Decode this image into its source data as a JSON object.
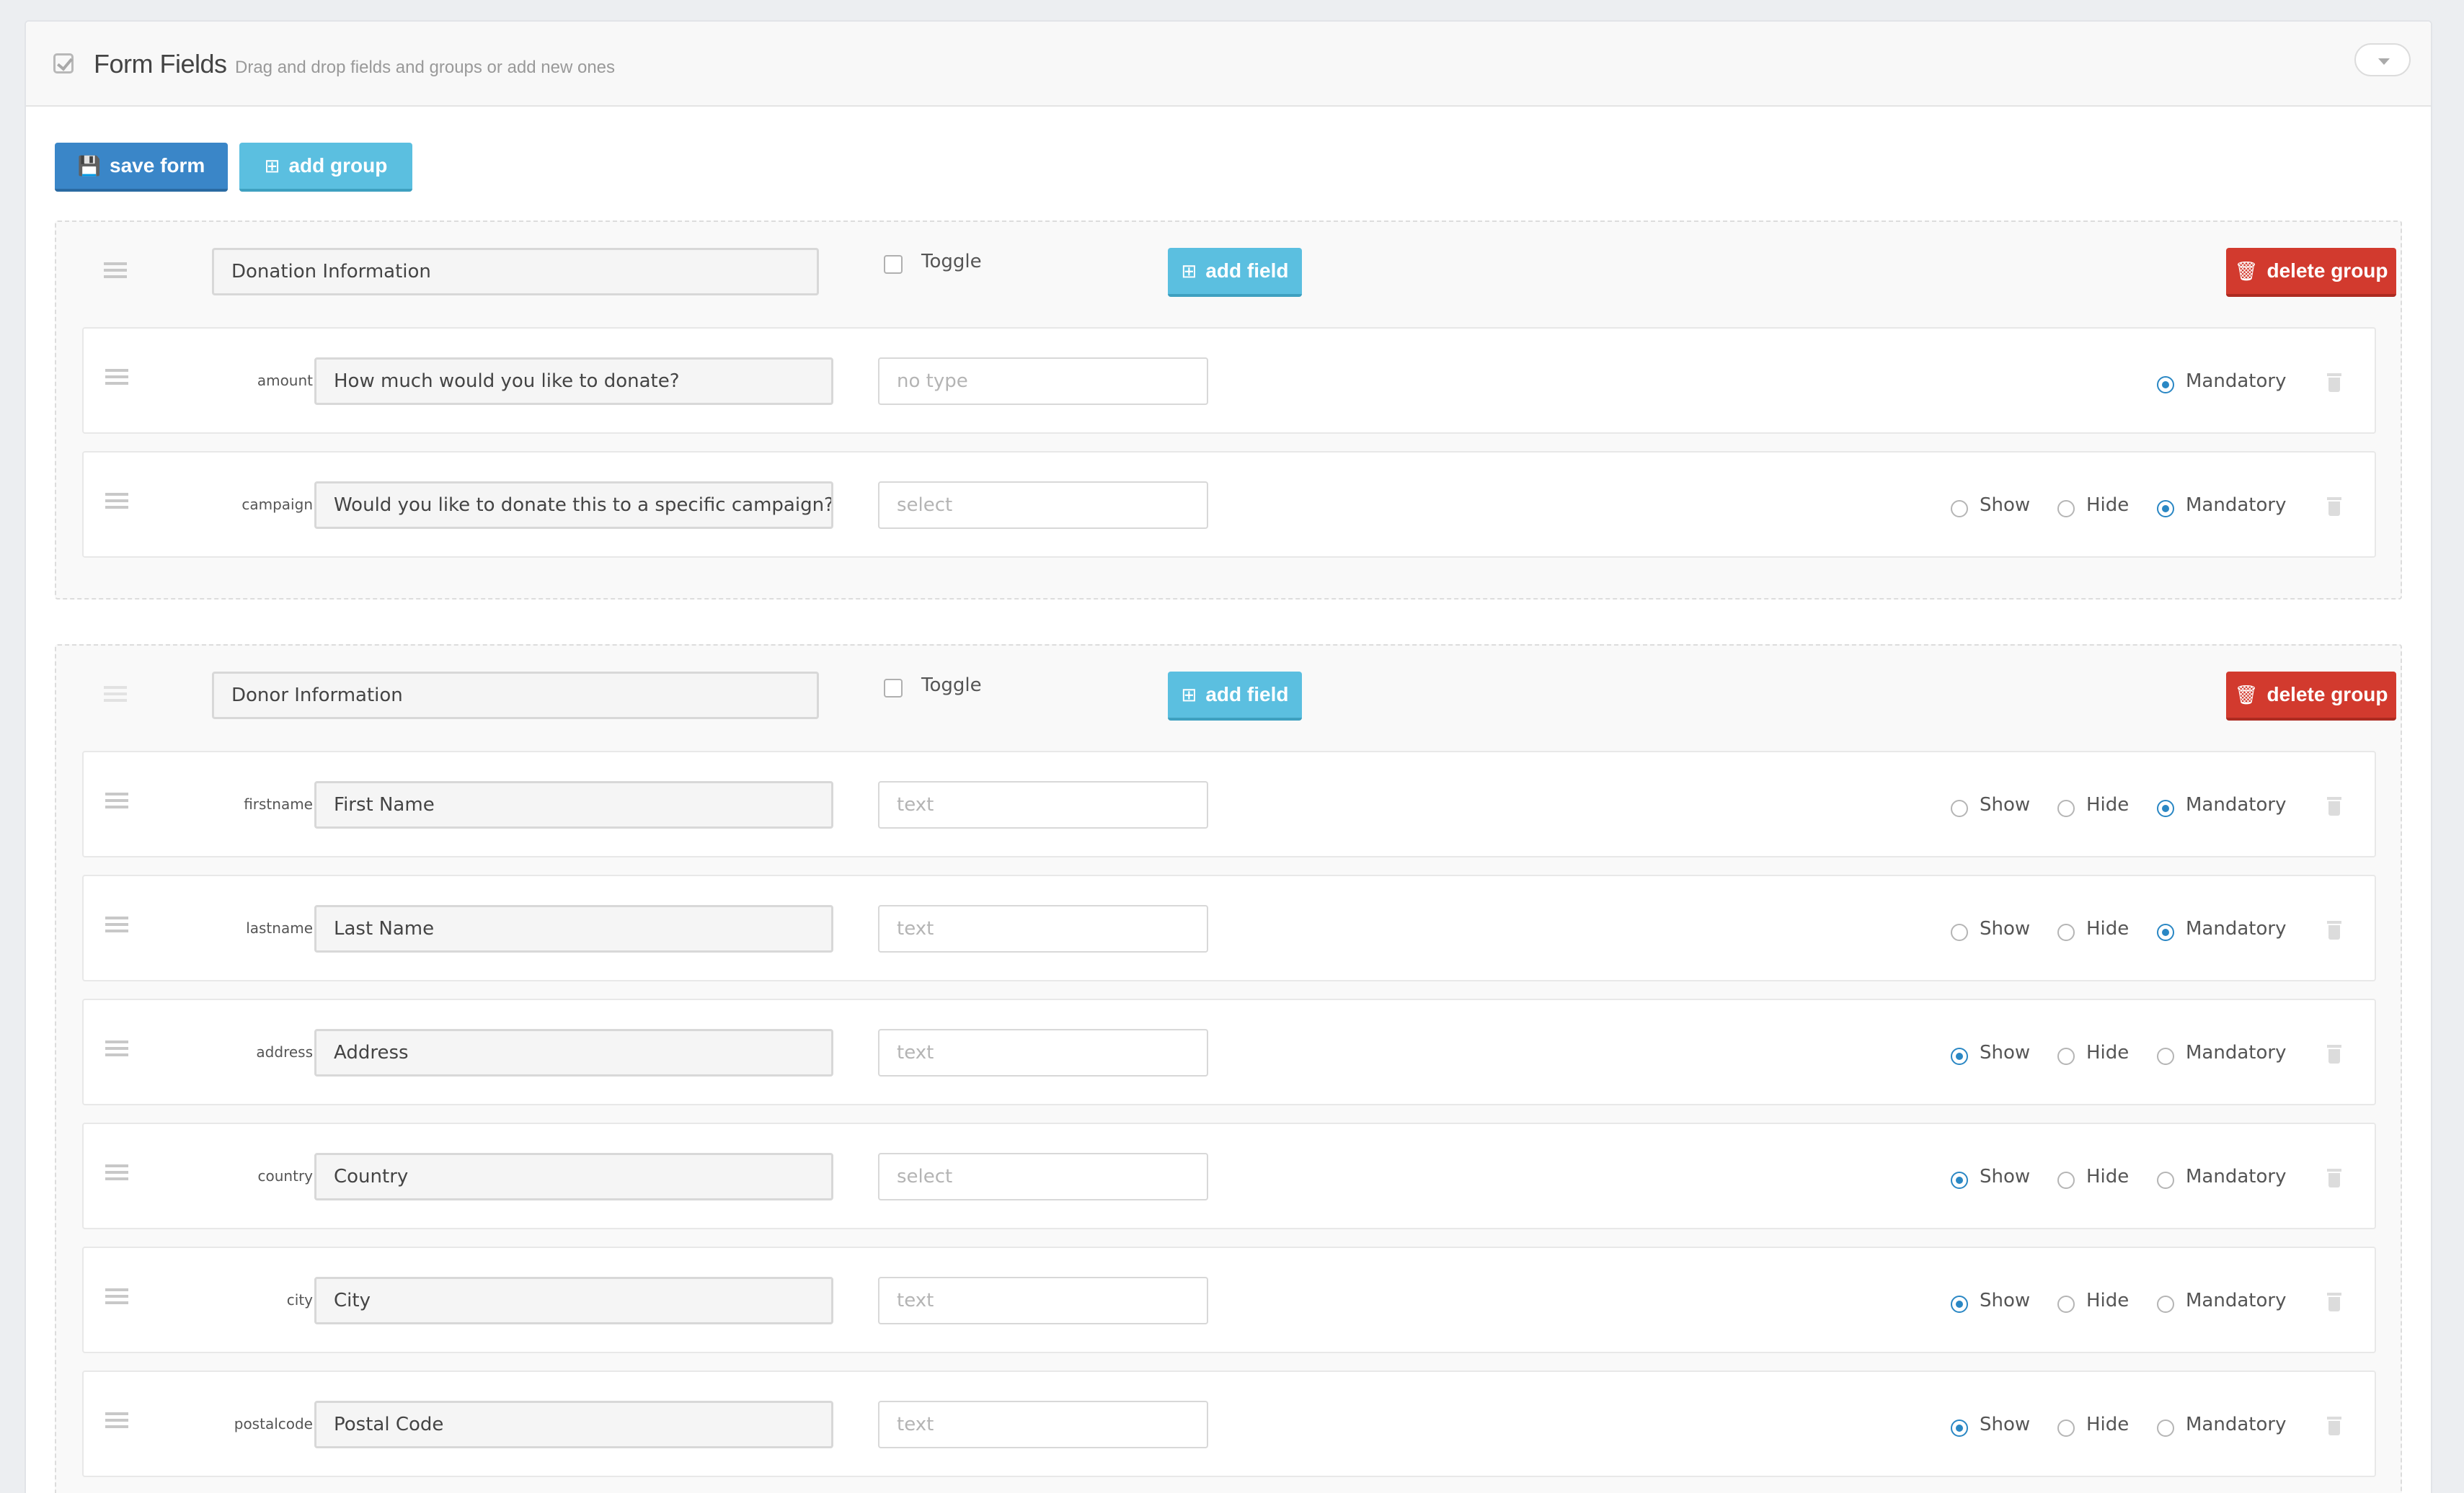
{
  "header": {
    "title": "Form Fields",
    "subtitle": "Drag and drop fields and groups or add new ones"
  },
  "toolbar": {
    "save_label": "save form",
    "add_group_label": "add group"
  },
  "group_actions": {
    "toggle_label": "Toggle",
    "add_field_label": "add field",
    "delete_group_label": "delete group"
  },
  "visibility_labels": {
    "show": "Show",
    "hide": "Hide",
    "mandatory": "Mandatory"
  },
  "groups": [
    {
      "name": "Donation Information",
      "toggle_checked": false,
      "fields": [
        {
          "key": "amount",
          "label": "How much would you like to donate?",
          "type": "no type",
          "options": [
            "mandatory"
          ],
          "selected": "mandatory"
        },
        {
          "key": "campaign",
          "label": "Would you like to donate this to a specific campaign?",
          "type": "select",
          "options": [
            "show",
            "hide",
            "mandatory"
          ],
          "selected": "mandatory"
        }
      ]
    },
    {
      "name": "Donor Information",
      "toggle_checked": false,
      "fields": [
        {
          "key": "firstname",
          "label": "First Name",
          "type": "text",
          "options": [
            "show",
            "hide",
            "mandatory"
          ],
          "selected": "mandatory"
        },
        {
          "key": "lastname",
          "label": "Last Name",
          "type": "text",
          "options": [
            "show",
            "hide",
            "mandatory"
          ],
          "selected": "mandatory"
        },
        {
          "key": "address",
          "label": "Address",
          "type": "text",
          "options": [
            "show",
            "hide",
            "mandatory"
          ],
          "selected": "show"
        },
        {
          "key": "country",
          "label": "Country",
          "type": "select",
          "options": [
            "show",
            "hide",
            "mandatory"
          ],
          "selected": "show"
        },
        {
          "key": "city",
          "label": "City",
          "type": "text",
          "options": [
            "show",
            "hide",
            "mandatory"
          ],
          "selected": "show"
        },
        {
          "key": "postalcode",
          "label": "Postal Code",
          "type": "text",
          "options": [
            "show",
            "hide",
            "mandatory"
          ],
          "selected": "show"
        }
      ]
    }
  ],
  "colors": {
    "primary": "#3a86c8",
    "info": "#5bbfe0",
    "danger": "#d23a2e",
    "radio_on": "#2a87c4"
  }
}
